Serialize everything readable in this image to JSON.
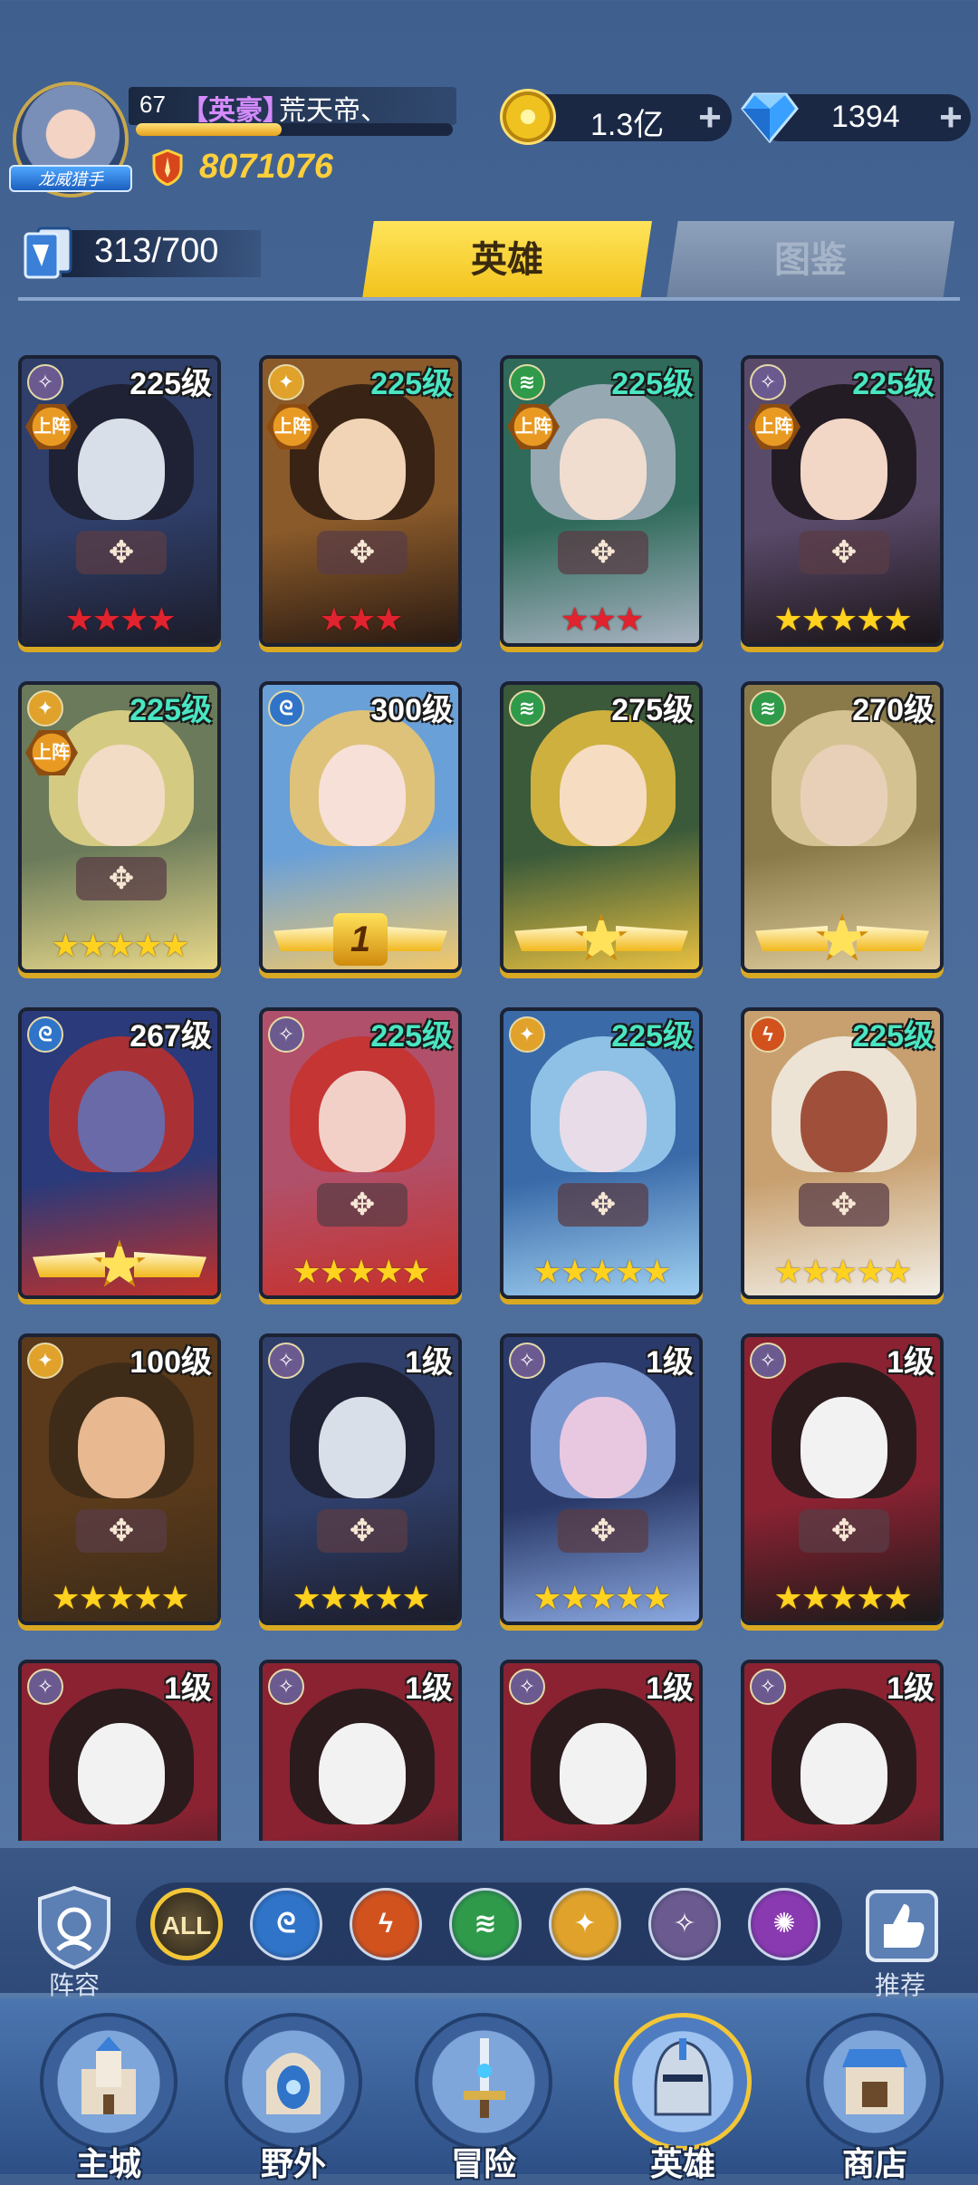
{
  "header": {
    "level": "67",
    "guild_tag": "【英豪】",
    "player_name": "荒天帝、",
    "avatar_badge": "龙威猎手",
    "power": "8071076",
    "gold": "1.3亿",
    "diamonds": "1394",
    "exp_fraction": 0.46
  },
  "collection": {
    "count": "313/700"
  },
  "tabs": {
    "heroes": "英雄",
    "codex": "图鉴"
  },
  "cards": [
    {
      "faction": "void",
      "level": "225级",
      "level_color": "white",
      "deployed": true,
      "deploy_label": "上阵",
      "stars": 4,
      "star_color": "red",
      "theme": [
        "#2f3f6a",
        "#d9dfe8",
        "#1c1c2a"
      ]
    },
    {
      "faction": "light",
      "level": "225级",
      "level_color": "teal",
      "deployed": true,
      "deploy_label": "上阵",
      "stars": 3,
      "star_color": "red",
      "theme": [
        "#8a5a2a",
        "#f1d3b5",
        "#2a1a12"
      ]
    },
    {
      "faction": "wind",
      "level": "225级",
      "level_color": "teal",
      "deployed": true,
      "deploy_label": "上阵",
      "stars": 3,
      "star_color": "red",
      "theme": [
        "#2f6a5a",
        "#f0ddd0",
        "#a8b3c2"
      ]
    },
    {
      "faction": "void",
      "level": "225级",
      "level_color": "teal",
      "deployed": true,
      "deploy_label": "上阵",
      "stars": 5,
      "star_color": "gold",
      "theme": [
        "#5a4a6a",
        "#f2d6c6",
        "#1a1418"
      ]
    },
    {
      "faction": "light",
      "level": "225级",
      "level_color": "teal",
      "deployed": true,
      "deploy_label": "上阵",
      "stars": 5,
      "star_color": "gold",
      "theme": [
        "#6a7a5a",
        "#f2dcc6",
        "#e8d88a"
      ]
    },
    {
      "faction": "water",
      "level": "300级",
      "level_color": "white",
      "deployed": false,
      "deploy_label": "",
      "stars": 0,
      "star_color": "gold",
      "rank_num": "1",
      "theme": [
        "#6aa0d8",
        "#f6e0d8",
        "#f2c86a"
      ]
    },
    {
      "faction": "wind",
      "level": "275级",
      "level_color": "white",
      "deployed": false,
      "deploy_label": "",
      "stars": 0,
      "star_color": "gold",
      "rank_star": true,
      "theme": [
        "#3a5a3a",
        "#f6dcc0",
        "#e8c040"
      ]
    },
    {
      "faction": "wind",
      "level": "270级",
      "level_color": "white",
      "deployed": false,
      "deploy_label": "",
      "stars": 0,
      "star_color": "gold",
      "rank_star": true,
      "theme": [
        "#8a7a4a",
        "#e8d0b8",
        "#e2cfa0"
      ]
    },
    {
      "faction": "water",
      "level": "267级",
      "level_color": "white",
      "deployed": false,
      "deploy_label": "",
      "stars": 0,
      "star_color": "gold",
      "rank_star": true,
      "theme": [
        "#2a3a7a",
        "#6a6aa8",
        "#c0302a"
      ]
    },
    {
      "faction": "void",
      "level": "225级",
      "level_color": "teal",
      "deployed": false,
      "deploy_label": "",
      "stars": 5,
      "star_color": "gold",
      "theme": [
        "#b0506a",
        "#f2d0c8",
        "#c8302a"
      ]
    },
    {
      "faction": "light",
      "level": "225级",
      "level_color": "teal",
      "deployed": false,
      "deploy_label": "",
      "stars": 5,
      "star_color": "gold",
      "theme": [
        "#3a6aa8",
        "#e8dce8",
        "#9fd0f2"
      ]
    },
    {
      "faction": "fire",
      "level": "225级",
      "level_color": "teal",
      "deployed": false,
      "deploy_label": "",
      "stars": 5,
      "star_color": "gold",
      "theme": [
        "#c8a070",
        "#a0503a",
        "#f2efe6"
      ]
    },
    {
      "faction": "light",
      "level": "100级",
      "level_color": "white",
      "deployed": false,
      "deploy_label": "",
      "stars": 5,
      "star_color": "gold",
      "theme": [
        "#5a3a1a",
        "#e8b890",
        "#3a2a1a"
      ]
    },
    {
      "faction": "void",
      "level": "1级",
      "level_color": "white",
      "deployed": false,
      "deploy_label": "",
      "stars": 5,
      "star_color": "gold",
      "theme": [
        "#2f3f6a",
        "#d9dfe8",
        "#1c1c2a"
      ]
    },
    {
      "faction": "void",
      "level": "1级",
      "level_color": "white",
      "deployed": false,
      "deploy_label": "",
      "stars": 5,
      "star_color": "gold",
      "theme": [
        "#2a3a6a",
        "#e8c8e0",
        "#8aa8e0"
      ]
    },
    {
      "faction": "void",
      "level": "1级",
      "level_color": "white",
      "deployed": false,
      "deploy_label": "",
      "stars": 5,
      "star_color": "gold",
      "theme": [
        "#8a2232",
        "#f2f2f2",
        "#1a1a1a"
      ]
    },
    {
      "faction": "void",
      "level": "1级",
      "level_color": "white",
      "deployed": false,
      "deploy_label": "",
      "stars": 0,
      "star_color": "gold",
      "theme": [
        "#8a2232",
        "#f2f2f2",
        "#1a1a1a"
      ]
    },
    {
      "faction": "void",
      "level": "1级",
      "level_color": "white",
      "deployed": false,
      "deploy_label": "",
      "stars": 0,
      "star_color": "gold",
      "theme": [
        "#8a2232",
        "#f2f2f2",
        "#1a1a1a"
      ]
    },
    {
      "faction": "void",
      "level": "1级",
      "level_color": "white",
      "deployed": false,
      "deploy_label": "",
      "stars": 0,
      "star_color": "gold",
      "theme": [
        "#8a2232",
        "#f2f2f2",
        "#1a1a1a"
      ]
    },
    {
      "faction": "void",
      "level": "1级",
      "level_color": "white",
      "deployed": false,
      "deploy_label": "",
      "stars": 0,
      "star_color": "gold",
      "theme": [
        "#8a2232",
        "#f2f2f2",
        "#1a1a1a"
      ]
    }
  ],
  "factions": {
    "void": {
      "color": "#6b5a8f",
      "glyph": "✧"
    },
    "light": {
      "color": "#e0a22a",
      "glyph": "✦"
    },
    "wind": {
      "color": "#2f9a4a",
      "glyph": "≋"
    },
    "water": {
      "color": "#2f74c8",
      "glyph": "ᘓ"
    },
    "fire": {
      "color": "#d2521e",
      "glyph": "ϟ"
    },
    "dark": {
      "color": "#8a3ab0",
      "glyph": "✺"
    }
  },
  "filter": {
    "lineup_label": "阵容",
    "recommend_label": "推荐",
    "all_label": "ALL",
    "buttons": [
      "water",
      "fire",
      "wind",
      "light",
      "void",
      "dark"
    ]
  },
  "nav": {
    "items": [
      {
        "label": "主城",
        "icon": "castle-icon"
      },
      {
        "label": "野外",
        "icon": "portal-icon"
      },
      {
        "label": "冒险",
        "icon": "sword-icon"
      },
      {
        "label": "英雄",
        "icon": "knight-helmet-icon",
        "active": true
      },
      {
        "label": "商店",
        "icon": "shop-icon"
      }
    ]
  }
}
